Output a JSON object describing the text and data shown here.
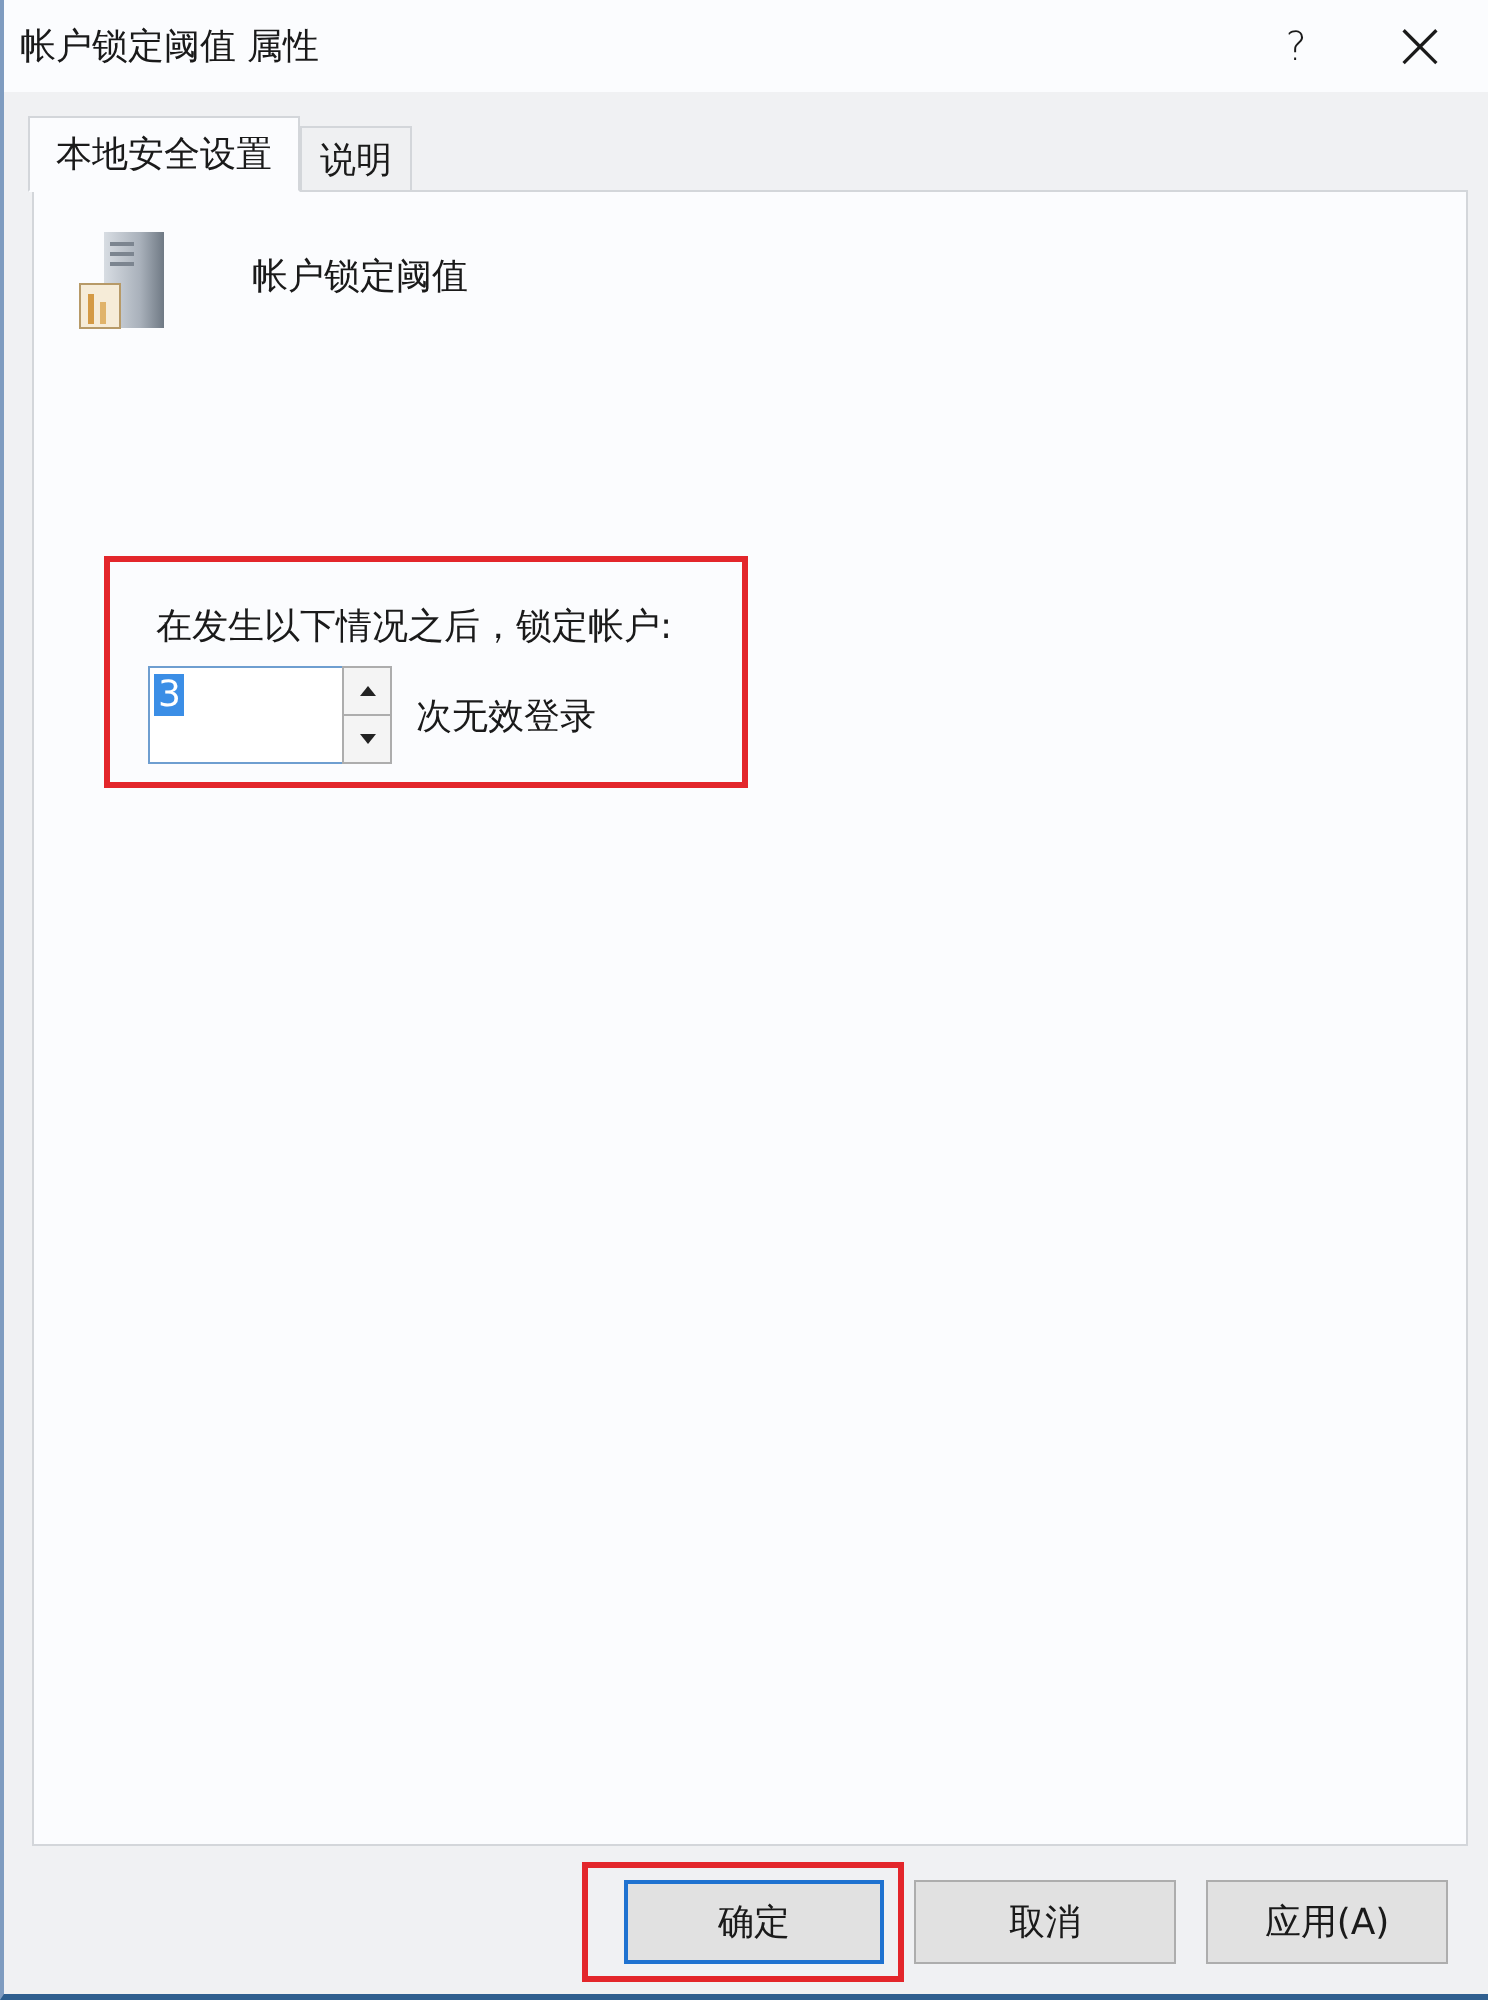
{
  "window": {
    "title": "帐户锁定阈值 属性",
    "help_button": "?",
    "close_button": "×"
  },
  "tabs": [
    {
      "label": "本地安全设置",
      "selected": true
    },
    {
      "label": "说明",
      "selected": false
    }
  ],
  "policy": {
    "name": "帐户锁定阈值"
  },
  "lockout_group": {
    "highlighted": true,
    "label": "在发生以下情况之后，锁定帐户:",
    "field": {
      "value": "3",
      "text_selected": true
    },
    "unit": "次无效登录"
  },
  "buttons": [
    {
      "label": "确定",
      "default": true,
      "highlighted": true
    },
    {
      "label": "取消",
      "default": false,
      "highlighted": false
    },
    {
      "label": "应用(A)",
      "default": false,
      "highlighted": false
    }
  ]
}
